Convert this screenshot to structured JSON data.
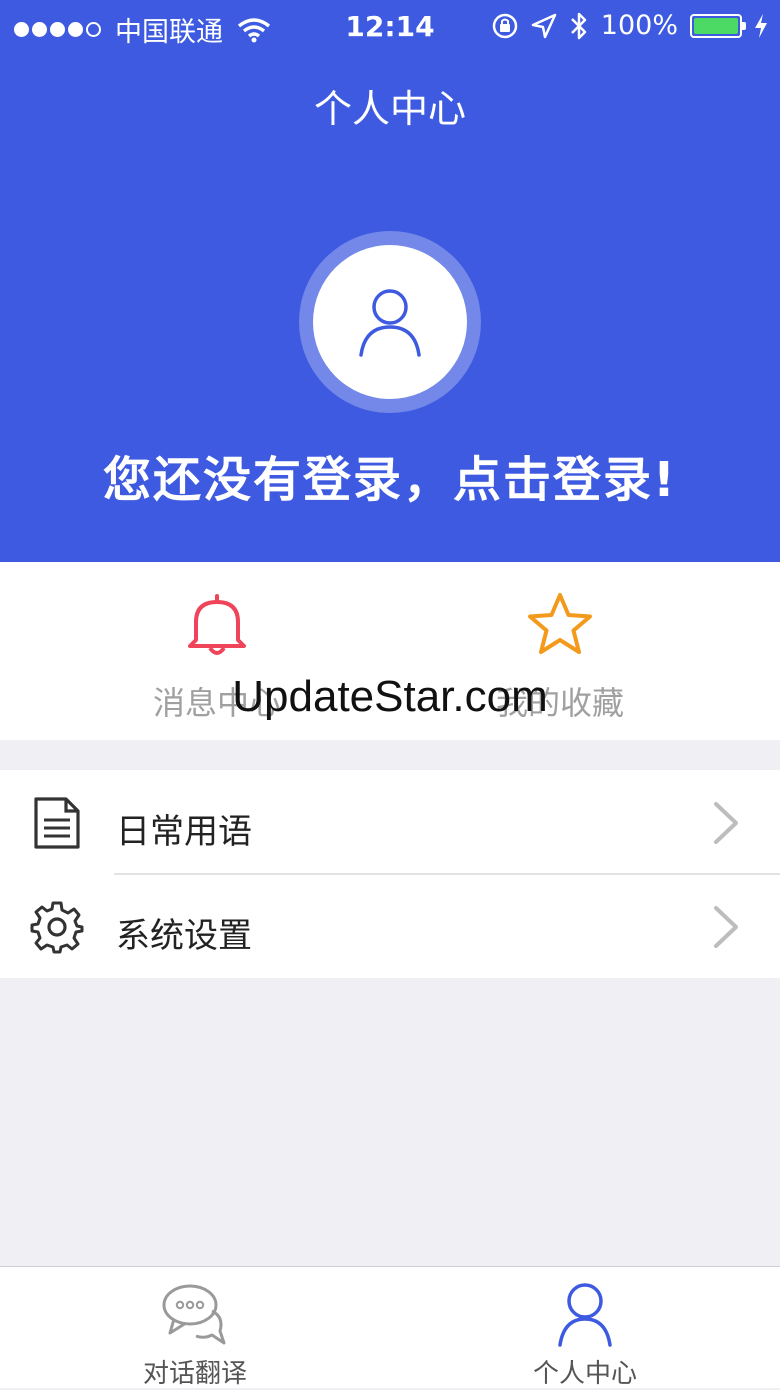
{
  "status_bar": {
    "carrier": "中国联通",
    "time": "12:14",
    "battery": "100%",
    "signal_dots_filled": 4,
    "signal_dots_total": 5,
    "battery_color": "#4cd964"
  },
  "header": {
    "title": "个人中心",
    "login_prompt": "您还没有登录，点击登录!",
    "background": "#3d5ae0"
  },
  "quick_actions": [
    {
      "label": "消息中心",
      "icon": "bell-icon",
      "color": "#f0445a"
    },
    {
      "label": "我的收藏",
      "icon": "star-icon",
      "color": "#f39a1d"
    }
  ],
  "watermark": "UpdateStar.com",
  "menu": [
    {
      "label": "日常用语",
      "icon": "document-icon"
    },
    {
      "label": "系统设置",
      "icon": "gear-icon"
    }
  ],
  "tabbar": [
    {
      "label": "对话翻译",
      "icon": "chat-bubble-icon",
      "active": false
    },
    {
      "label": "个人中心",
      "icon": "person-icon",
      "active": true
    }
  ],
  "accent_color": "#3d5ae0"
}
